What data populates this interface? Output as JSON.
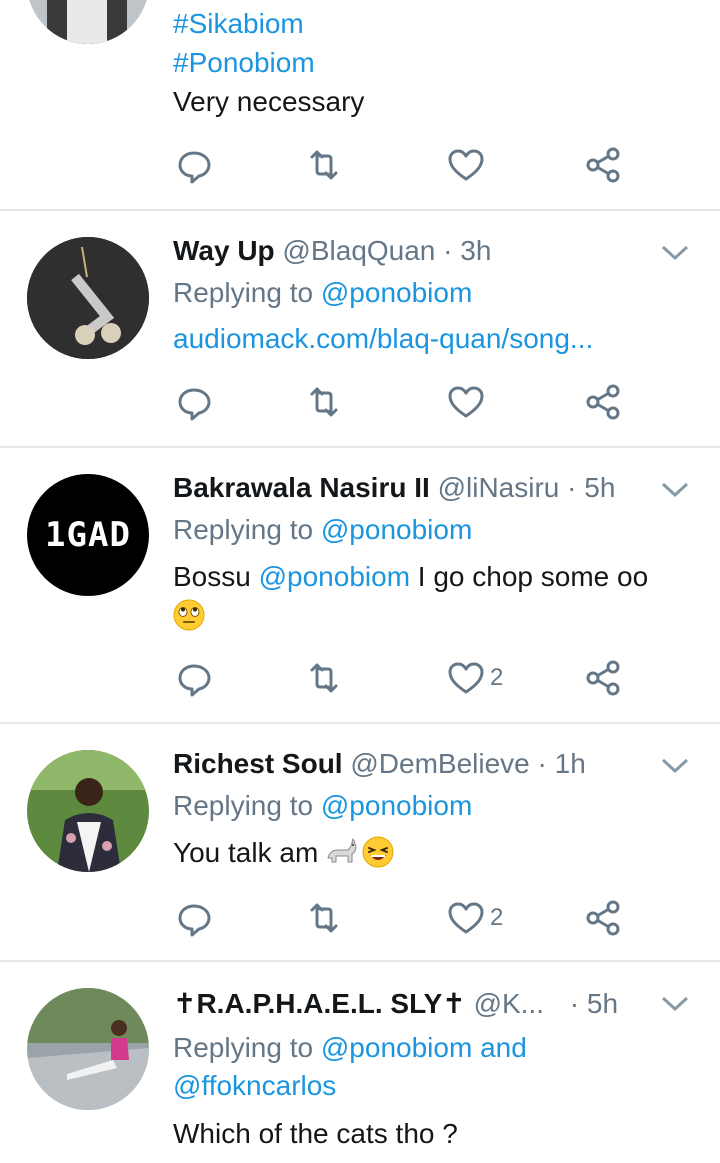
{
  "tweet0": {
    "lines": [
      "#Sikabiom",
      "#Ponobiom",
      "Very necessary"
    ],
    "like_count": "",
    "icons": [
      "reply-icon",
      "retweet-icon",
      "like-icon",
      "share-icon"
    ]
  },
  "tweet1": {
    "name": "Way Up",
    "handle": "@BlaqQuan",
    "time": "· 3h",
    "replying_prefix": "Replying to",
    "replying_user": "@ponobiom",
    "link": "audiomack.com/blaq-quan/song...",
    "like_count": ""
  },
  "tweet2": {
    "name": "Bakrawala Nasiru II",
    "handle": "@liNasiru",
    "time": "· 5h",
    "avatar_text": "1GAD",
    "replying_prefix": "Replying to",
    "replying_user": "@ponobiom",
    "text_prefix": "Bossu",
    "text_mention": "@ponobiom",
    "text_suffix": "I go chop some oo",
    "like_count": "2"
  },
  "tweet3": {
    "name": "Richest Soul",
    "handle": "@DemBelieve",
    "time": "· 1h",
    "replying_prefix": "Replying to",
    "replying_user": "@ponobiom",
    "text": "You talk am",
    "like_count": "2"
  },
  "tweet4": {
    "name": "✝R.A.P.H.A.E.L. SLY✝",
    "handle": "@K...",
    "time": "· 5h",
    "replying_prefix": "Replying to",
    "replying_user": "@ponobiom",
    "replying_and": "and",
    "replying_user2": "@ffokncarlos",
    "text": "Which of the cats tho ?"
  },
  "colors": {
    "link": "#1b95e0",
    "muted": "#657786",
    "text": "#14171a",
    "divider": "#e3e8ec"
  }
}
